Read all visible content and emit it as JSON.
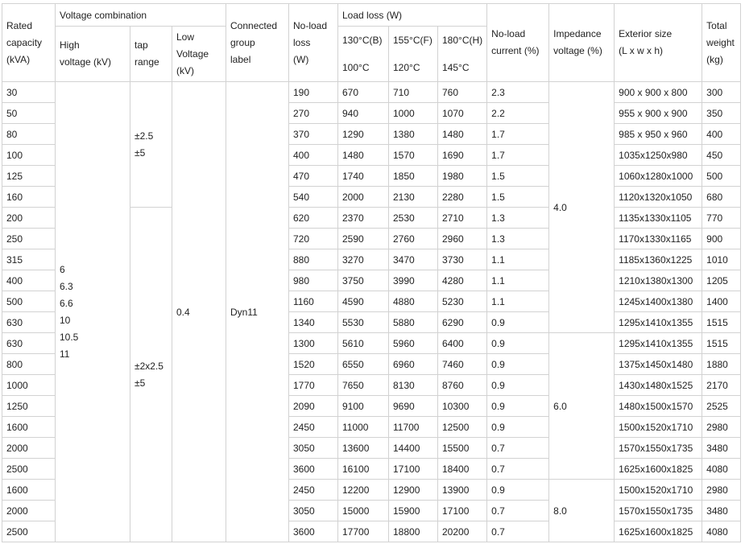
{
  "table": {
    "headers": {
      "rated_capacity": [
        "Rated",
        "capacity",
        "(kVA)"
      ],
      "voltage_combination": "Voltage combination",
      "high_voltage": [
        "High",
        "voltage (kV)"
      ],
      "tap_range": [
        "tap",
        "range"
      ],
      "low_voltage": [
        "Low",
        "Voltage",
        "(kV)"
      ],
      "connected_group": [
        "Connected",
        "group",
        "label"
      ],
      "noload_loss": [
        "No-load",
        "loss",
        "(W)"
      ],
      "load_loss": "Load loss (W)",
      "load_loss_cols": [
        {
          "top": "130°C(B)",
          "bottom": "100°C"
        },
        {
          "top": "155°C(F)",
          "bottom": "120°C"
        },
        {
          "top": "180°C(H)",
          "bottom": "145°C"
        }
      ],
      "noload_current": [
        "No-load",
        "current (%)"
      ],
      "impedance": [
        "Impedance",
        "voltage (%)"
      ],
      "exterior": [
        "Exterior size",
        "(L x w x h)"
      ],
      "total_weight": [
        "Total",
        "weight",
        "(kg)"
      ]
    },
    "high_voltage_values": [
      "6",
      "6.3",
      "6.6",
      "10",
      "10.5",
      "11"
    ],
    "tap_range_a": [
      "±2.5",
      "±5"
    ],
    "tap_range_b": [
      "±2x2.5",
      "±5"
    ],
    "low_voltage_value": "0.4",
    "group_label": "Dyn11",
    "impedance_values": [
      "4.0",
      "6.0",
      "8.0"
    ],
    "rows": [
      {
        "capacity": "30",
        "noload": "190",
        "b": "670",
        "f": "710",
        "h": "760",
        "current": "2.3",
        "size": "900 x 900 x 800",
        "weight": "300"
      },
      {
        "capacity": "50",
        "noload": "270",
        "b": "940",
        "f": "1000",
        "h": "1070",
        "current": "2.2",
        "size": "955 x 900 x 900",
        "weight": "350"
      },
      {
        "capacity": "80",
        "noload": "370",
        "b": "1290",
        "f": "1380",
        "h": "1480",
        "current": "1.7",
        "size": "985 x 950 x 960",
        "weight": "400"
      },
      {
        "capacity": "100",
        "noload": "400",
        "b": "1480",
        "f": "1570",
        "h": "1690",
        "current": "1.7",
        "size": "1035x1250x980",
        "weight": "450"
      },
      {
        "capacity": "125",
        "noload": "470",
        "b": "1740",
        "f": "1850",
        "h": "1980",
        "current": "1.5",
        "size": "1060x1280x1000",
        "weight": "500"
      },
      {
        "capacity": "160",
        "noload": "540",
        "b": "2000",
        "f": "2130",
        "h": "2280",
        "current": "1.5",
        "size": "1120x1320x1050",
        "weight": "680"
      },
      {
        "capacity": "200",
        "noload": "620",
        "b": "2370",
        "f": "2530",
        "h": "2710",
        "current": "1.3",
        "size": "1135x1330x1105",
        "weight": "770"
      },
      {
        "capacity": "250",
        "noload": "720",
        "b": "2590",
        "f": "2760",
        "h": "2960",
        "current": "1.3",
        "size": "1170x1330x1165",
        "weight": "900"
      },
      {
        "capacity": "315",
        "noload": "880",
        "b": "3270",
        "f": "3470",
        "h": "3730",
        "current": "1.1",
        "size": "1185x1360x1225",
        "weight": "1010"
      },
      {
        "capacity": "400",
        "noload": "980",
        "b": "3750",
        "f": "3990",
        "h": "4280",
        "current": "1.1",
        "size": "1210x1380x1300",
        "weight": "1205"
      },
      {
        "capacity": "500",
        "noload": "1160",
        "b": "4590",
        "f": "4880",
        "h": "5230",
        "current": "1.1",
        "size": "1245x1400x1380",
        "weight": "1400"
      },
      {
        "capacity": "630",
        "noload": "1340",
        "b": "5530",
        "f": "5880",
        "h": "6290",
        "current": "0.9",
        "size": "1295x1410x1355",
        "weight": "1515"
      },
      {
        "capacity": "630",
        "noload": "1300",
        "b": "5610",
        "f": "5960",
        "h": "6400",
        "current": "0.9",
        "size": "1295x1410x1355",
        "weight": "1515"
      },
      {
        "capacity": "800",
        "noload": "1520",
        "b": "6550",
        "f": "6960",
        "h": "7460",
        "current": "0.9",
        "size": "1375x1450x1480",
        "weight": "1880"
      },
      {
        "capacity": "1000",
        "noload": "1770",
        "b": "7650",
        "f": "8130",
        "h": "8760",
        "current": "0.9",
        "size": "1430x1480x1525",
        "weight": "2170"
      },
      {
        "capacity": "1250",
        "noload": "2090",
        "b": "9100",
        "f": "9690",
        "h": "10300",
        "current": "0.9",
        "size": "1480x1500x1570",
        "weight": "2525"
      },
      {
        "capacity": "1600",
        "noload": "2450",
        "b": "11000",
        "f": "11700",
        "h": "12500",
        "current": "0.9",
        "size": "1500x1520x1710",
        "weight": "2980"
      },
      {
        "capacity": "2000",
        "noload": "3050",
        "b": "13600",
        "f": "14400",
        "h": "15500",
        "current": "0.7",
        "size": "1570x1550x1735",
        "weight": "3480"
      },
      {
        "capacity": "2500",
        "noload": "3600",
        "b": "16100",
        "f": "17100",
        "h": "18400",
        "current": "0.7",
        "size": "1625x1600x1825",
        "weight": "4080"
      },
      {
        "capacity": "1600",
        "noload": "2450",
        "b": "12200",
        "f": "12900",
        "h": "13900",
        "current": "0.9",
        "size": "1500x1520x1710",
        "weight": "2980"
      },
      {
        "capacity": "2000",
        "noload": "3050",
        "b": "15000",
        "f": "15900",
        "h": "17100",
        "current": "0.7",
        "size": "1570x1550x1735",
        "weight": "3480"
      },
      {
        "capacity": "2500",
        "noload": "3600",
        "b": "17700",
        "f": "18800",
        "h": "20200",
        "current": "0.7",
        "size": "1625x1600x1825",
        "weight": "4080"
      }
    ]
  }
}
